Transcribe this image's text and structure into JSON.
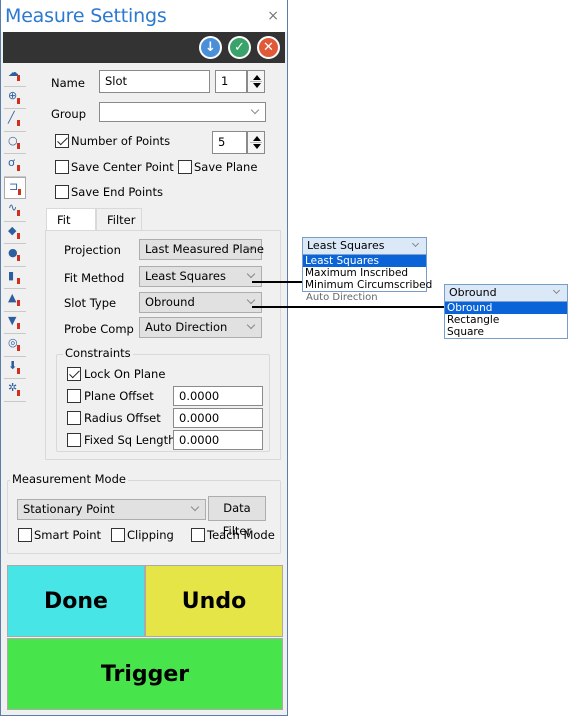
{
  "window": {
    "title": "Measure Settings",
    "close_glyph": "×",
    "toolbar": {
      "buttons": [
        {
          "name": "download",
          "icon": "arrow-down-circle-icon",
          "glyph": "↓",
          "color": "#4a8fd8"
        },
        {
          "name": "accept",
          "icon": "check-circle-icon",
          "glyph": "✓",
          "color": "#3aa36a"
        },
        {
          "name": "cancel",
          "icon": "x-circle-icon",
          "glyph": "✕",
          "color": "#e05a3a"
        }
      ]
    }
  },
  "sidebar": {
    "items": [
      {
        "name": "auto-feature",
        "glyph": "☁"
      },
      {
        "name": "point",
        "glyph": "⊕"
      },
      {
        "name": "line",
        "glyph": "╱"
      },
      {
        "name": "circle",
        "glyph": "○"
      },
      {
        "name": "ellipse",
        "glyph": "ơ"
      },
      {
        "name": "slot",
        "glyph": "⊐",
        "active": true
      },
      {
        "name": "curve",
        "glyph": "∿"
      },
      {
        "name": "plane",
        "glyph": "◆"
      },
      {
        "name": "sphere",
        "glyph": "●"
      },
      {
        "name": "cylinder",
        "glyph": "▮"
      },
      {
        "name": "cone",
        "glyph": "▲"
      },
      {
        "name": "flat-cone",
        "glyph": "▼"
      },
      {
        "name": "torus",
        "glyph": "◎"
      },
      {
        "name": "edge-point",
        "glyph": "⬇"
      },
      {
        "name": "polygon",
        "glyph": "✲"
      }
    ]
  },
  "form": {
    "name_label": "Name",
    "name_value": "Slot",
    "name_index": "1",
    "group_label": "Group",
    "group_value": "",
    "num_points_label": "Number of Points",
    "num_points_checked": true,
    "num_points_value": "5",
    "save_center_point_label": "Save Center Point",
    "save_center_point_checked": false,
    "save_plane_label": "Save Plane",
    "save_plane_checked": false,
    "save_end_points_label": "Save End Points",
    "save_end_points_checked": false
  },
  "tabs": [
    {
      "label": "Fit",
      "active": true
    },
    {
      "label": "Filter",
      "active": false
    }
  ],
  "fit": {
    "projection_label": "Projection",
    "projection_value": "Last Measured Plane",
    "fit_method_label": "Fit Method",
    "fit_method_value": "Least Squares",
    "slot_type_label": "Slot Type",
    "slot_type_value": "Obround",
    "probe_comp_label": "Probe Comp",
    "probe_comp_value": "Auto Direction",
    "constraints": {
      "title": "Constraints",
      "lock_on_plane_label": "Lock On Plane",
      "lock_on_plane_checked": true,
      "plane_offset_label": "Plane Offset",
      "plane_offset_checked": false,
      "plane_offset_value": "0.0000",
      "radius_offset_label": "Radius Offset",
      "radius_offset_checked": false,
      "radius_offset_value": "0.0000",
      "fixed_sq_length_label": "Fixed Sq Length",
      "fixed_sq_length_checked": false,
      "fixed_sq_length_value": "0.0000"
    }
  },
  "measurement_mode": {
    "title": "Measurement Mode",
    "mode_value": "Stationary Point",
    "data_filter_label": "Data Filter",
    "smart_point_label": "Smart Point",
    "smart_point_checked": false,
    "clipping_label": "Clipping",
    "clipping_checked": false,
    "teach_mode_label": "Teach Mode",
    "teach_mode_checked": false
  },
  "actions": {
    "done_label": "Done",
    "done_color": "#47e5e5",
    "undo_label": "Undo",
    "undo_color": "#e5e547",
    "trigger_label": "Trigger",
    "trigger_color": "#47e54b"
  },
  "callouts": {
    "fit_method_dropdown": {
      "selected": "Least Squares",
      "options": [
        "Least Squares",
        "Maximum Inscribed",
        "Minimum Circumscribed"
      ],
      "highlighted": "Least Squares",
      "ghost_text": "Auto Direction"
    },
    "slot_type_dropdown": {
      "selected": "Obround",
      "options": [
        "Obround",
        "Rectangle",
        "Square"
      ],
      "highlighted": "Obround"
    }
  }
}
